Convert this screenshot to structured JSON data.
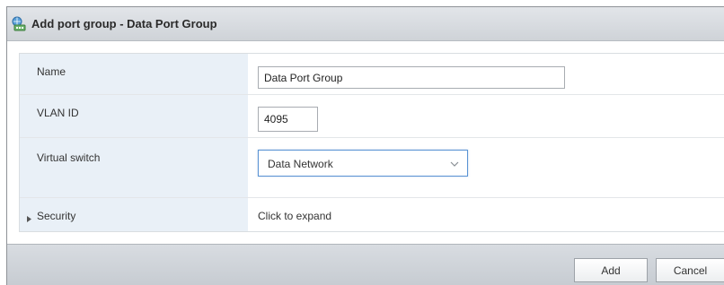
{
  "dialog": {
    "title": "Add port group - Data Port Group",
    "title_icon": "network-port-group-icon"
  },
  "form": {
    "name": {
      "label": "Name",
      "value": "Data Port Group"
    },
    "vlan": {
      "label": "VLAN ID",
      "value": "4095"
    },
    "vswitch": {
      "label": "Virtual switch",
      "selected": "Data Network"
    },
    "security": {
      "label": "Security",
      "value": "Click to expand"
    }
  },
  "buttons": {
    "add": "Add",
    "cancel": "Cancel"
  },
  "colors": {
    "label_bg": "#e9f0f7",
    "select_focus_border": "#5a93d4",
    "titlebar": "#d8dce1"
  }
}
